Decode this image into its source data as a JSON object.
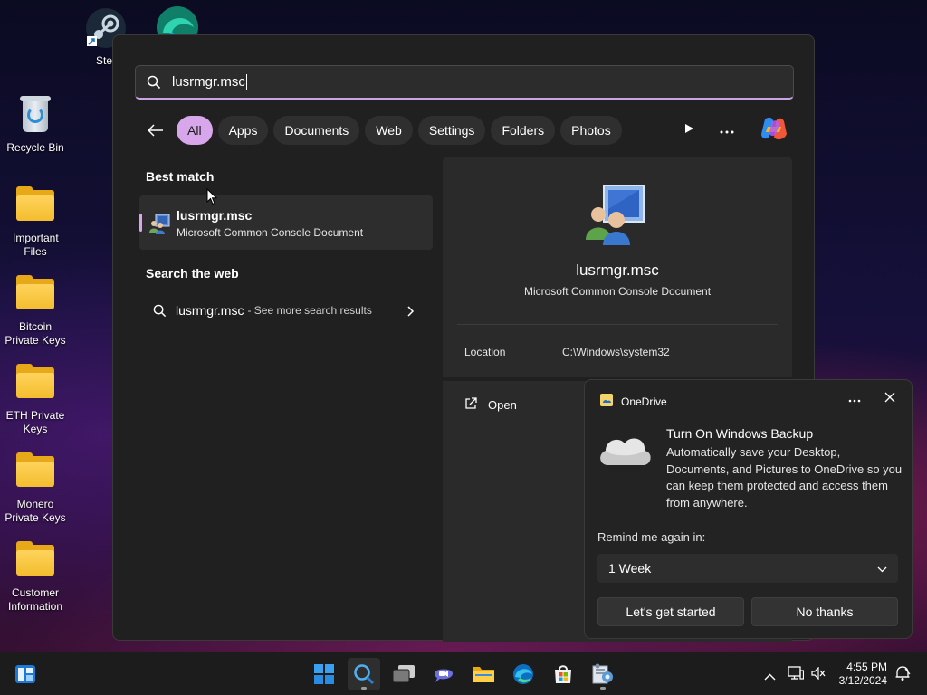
{
  "desktop": {
    "top_icons": [
      {
        "label": "Steam",
        "name": "steam"
      },
      {
        "label": "",
        "name": "microsoft-edge-dev"
      }
    ],
    "icons": [
      {
        "label": "Recycle Bin",
        "kind": "recycle-bin"
      },
      {
        "label": "Important Files",
        "kind": "folder"
      },
      {
        "label": "Bitcoin Private Keys",
        "kind": "folder"
      },
      {
        "label": "ETH Private Keys",
        "kind": "folder"
      },
      {
        "label": "Monero Private Keys",
        "kind": "folder"
      },
      {
        "label": "Customer Information",
        "kind": "folder"
      }
    ]
  },
  "search": {
    "query": "lusrmgr.msc",
    "icon": "search-icon",
    "filters": [
      "All",
      "Apps",
      "Documents",
      "Web",
      "Settings",
      "Folders",
      "Photos"
    ],
    "active_filter": "All",
    "accent_color": "#d8a6ea",
    "best_match_title": "Best match",
    "best_match": {
      "name": "lusrmgr.msc",
      "type": "Microsoft Common Console Document"
    },
    "web_title": "Search the web",
    "web_result": {
      "query": "lusrmgr.msc",
      "suffix": "- See more search results"
    },
    "detail": {
      "name": "lusrmgr.msc",
      "type": "Microsoft Common Console Document",
      "location_label": "Location",
      "location_value": "C:\\Windows\\system32",
      "actions": [
        {
          "label": "Open",
          "icon": "open-external-icon"
        }
      ]
    }
  },
  "toast": {
    "app": "OneDrive",
    "title": "Turn On Windows Backup",
    "body": "Automatically save your Desktop, Documents, and Pictures to OneDrive so you can keep them protected and access them from anywhere.",
    "remind_label": "Remind me again in:",
    "remind_value": "1 Week",
    "primary_button": "Let's get started",
    "secondary_button": "No thanks"
  },
  "taskbar": {
    "apps": [
      "widgets",
      "start",
      "search",
      "task-view",
      "teams-chat",
      "file-explorer",
      "edge",
      "microsoft-store",
      "computer-management"
    ],
    "active_app": "search",
    "clock": {
      "time": "4:55 PM",
      "date": "3/12/2024"
    }
  }
}
